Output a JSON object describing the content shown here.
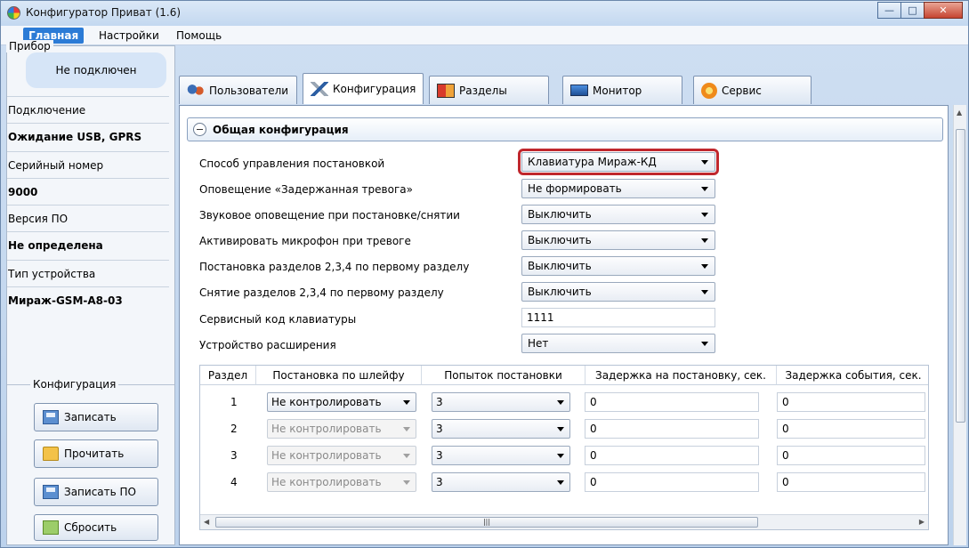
{
  "window": {
    "title": "Конфигуратор Приват (1.6)"
  },
  "menu": [
    "Главная",
    "Настройки",
    "Помощь"
  ],
  "left": {
    "device_group": "Прибор",
    "status": "Не подключен",
    "rows": [
      {
        "label": "Подключение",
        "value": "Ожидание USB, GPRS"
      },
      {
        "label": "Серийный номер",
        "value": "9000"
      },
      {
        "label": "Версия ПО",
        "value": "Не определена"
      },
      {
        "label": "Тип устройства",
        "value": "Мираж-GSM-A8-03"
      }
    ],
    "config_group": "Конфигурация",
    "buttons": [
      {
        "label": "Записать",
        "icon": "floppy-icon"
      },
      {
        "label": "Прочитать",
        "icon": "folder-icon"
      },
      {
        "label": "Записать ПО",
        "icon": "floppy-icon"
      },
      {
        "label": "Сбросить",
        "icon": "reset-icon"
      }
    ]
  },
  "tabs": [
    {
      "label": "Пользователи",
      "icon": "users-icon"
    },
    {
      "label": "Конфигурация",
      "icon": "tools-icon"
    },
    {
      "label": "Разделы",
      "icon": "partitions-icon"
    },
    {
      "label": "Монитор",
      "icon": "monitor-icon"
    },
    {
      "label": "Сервис",
      "icon": "service-icon"
    }
  ],
  "active_tab": "Конфигурация",
  "section": {
    "title": "Общая конфигурация"
  },
  "fields": [
    {
      "label": "Способ управления постановкой",
      "value": "Клавиатура Мираж-КД",
      "type": "select",
      "highlighted": true
    },
    {
      "label": "Оповещение «Задержанная тревога»",
      "value": "Не формировать",
      "type": "select"
    },
    {
      "label": "Звуковое оповещение при постановке/снятии",
      "value": "Выключить",
      "type": "select"
    },
    {
      "label": "Активировать микрофон при тревоге",
      "value": "Выключить",
      "type": "select"
    },
    {
      "label": "Постановка разделов 2,3,4 по первому разделу",
      "value": "Выключить",
      "type": "select"
    },
    {
      "label": "Снятие разделов 2,3,4 по первому разделу",
      "value": "Выключить",
      "type": "select"
    },
    {
      "label": "Сервисный код клавиатуры",
      "value": "1111",
      "type": "text"
    },
    {
      "label": "Устройство расширения",
      "value": "Нет",
      "type": "select"
    }
  ],
  "grid": {
    "headers": [
      "Раздел",
      "Постановка по шлейфу",
      "Попыток постановки",
      "Задержка на постановку, сек.",
      "Задержка события, сек."
    ],
    "rows": [
      {
        "num": "1",
        "loop": "Не контролировать",
        "loop_disabled": false,
        "attempts": "3",
        "delay": "0",
        "event_delay": "0"
      },
      {
        "num": "2",
        "loop": "Не контролировать",
        "loop_disabled": true,
        "attempts": "3",
        "delay": "0",
        "event_delay": "0"
      },
      {
        "num": "3",
        "loop": "Не контролировать",
        "loop_disabled": true,
        "attempts": "3",
        "delay": "0",
        "event_delay": "0"
      },
      {
        "num": "4",
        "loop": "Не контролировать",
        "loop_disabled": true,
        "attempts": "3",
        "delay": "0",
        "event_delay": "0"
      }
    ]
  },
  "colors": {
    "accent": "#2b7bd6",
    "highlight": "#c0272d",
    "panel_bg": "#f3f6fa"
  }
}
